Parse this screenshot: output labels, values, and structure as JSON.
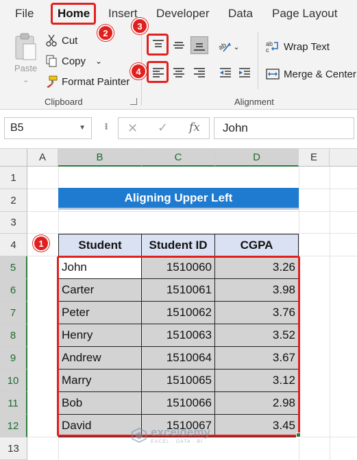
{
  "ribbon": {
    "tabs": [
      "File",
      "Home",
      "Insert",
      "Developer",
      "Data",
      "Page Layout"
    ],
    "clipboard": {
      "paste_label": "Paste",
      "cut_label": "Cut",
      "copy_label": "Copy",
      "format_painter_label": "Format Painter",
      "group_label": "Clipboard"
    },
    "alignment": {
      "wrap_text_label": "Wrap Text",
      "merge_center_label": "Merge & Center",
      "group_label": "Alignment"
    },
    "callouts": [
      "1",
      "2",
      "3",
      "4"
    ]
  },
  "formula_bar": {
    "name_box": "B5",
    "fx_label": "fx",
    "formula": "John"
  },
  "grid": {
    "columns": [
      "A",
      "B",
      "C",
      "D",
      "E"
    ],
    "rows": [
      "1",
      "2",
      "3",
      "4",
      "5",
      "6",
      "7",
      "8",
      "9",
      "10",
      "11",
      "12",
      "13"
    ],
    "title": "Aligning Upper Left",
    "table_headers": [
      "Student",
      "Student ID",
      "CGPA"
    ],
    "table_rows": [
      [
        "John",
        "1510060",
        "3.26"
      ],
      [
        "Carter",
        "1510061",
        "3.98"
      ],
      [
        "Peter",
        "1510062",
        "3.76"
      ],
      [
        "Henry",
        "1510063",
        "3.52"
      ],
      [
        "Andrew",
        "1510064",
        "3.67"
      ],
      [
        "Marry",
        "1510065",
        "3.12"
      ],
      [
        "Bob",
        "1510066",
        "2.98"
      ],
      [
        "David",
        "1510067",
        "3.45"
      ]
    ]
  },
  "watermark": {
    "name": "exceldemy",
    "tagline": "EXCEL · DATA · BI"
  },
  "colors": {
    "accent_red": "#e0201e",
    "title_blue": "#1f7bd0",
    "header_fill": "#d9e1f2",
    "selection_gray": "#d3d3d3",
    "excel_green": "#2a7d3a"
  }
}
